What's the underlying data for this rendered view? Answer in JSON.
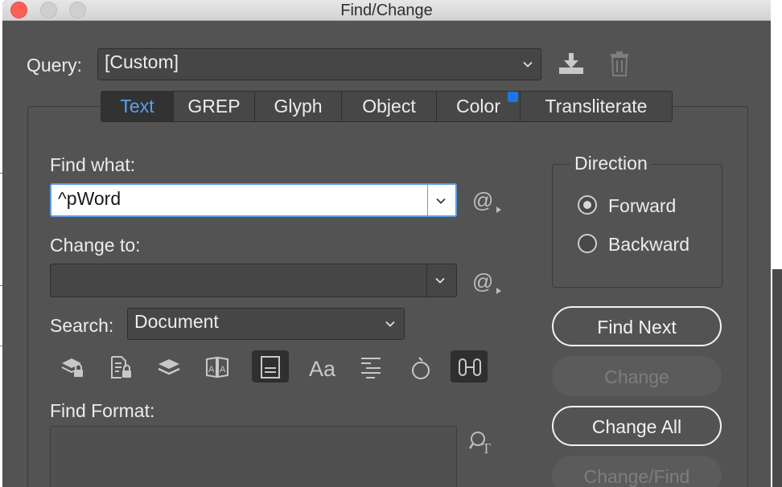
{
  "window": {
    "title": "Find/Change"
  },
  "query": {
    "label": "Query:",
    "value": "[Custom]"
  },
  "tabs": [
    {
      "label": "Text",
      "active": true
    },
    {
      "label": "GREP",
      "active": false
    },
    {
      "label": "Glyph",
      "active": false
    },
    {
      "label": "Object",
      "active": false
    },
    {
      "label": "Color",
      "active": false,
      "indicator": true
    },
    {
      "label": "Transliterate",
      "active": false
    }
  ],
  "find": {
    "label": "Find what:",
    "value": "^pWord"
  },
  "change": {
    "label": "Change to:",
    "value": ""
  },
  "search": {
    "label": "Search:",
    "value": "Document"
  },
  "direction": {
    "legend": "Direction",
    "options": [
      {
        "label": "Forward",
        "selected": true
      },
      {
        "label": "Backward",
        "selected": false
      }
    ]
  },
  "buttons": {
    "find_next": "Find Next",
    "change": "Change",
    "change_all": "Change All",
    "change_find": "Change/Find"
  },
  "find_format": {
    "label": "Find Format:"
  },
  "option_icons": [
    "locked-layers-icon",
    "locked-stories-icon",
    "hidden-layers-icon",
    "master-pages-icon",
    "footnotes-icon",
    "case-sensitive-icon",
    "whole-word-icon",
    "kana-sensitive-icon",
    "width-sensitive-icon"
  ],
  "colors": {
    "dialog_bg": "#535353",
    "active_tab_text": "#5aa0e8",
    "indicator": "#1e76e6",
    "close_button": "#fc5f57"
  }
}
